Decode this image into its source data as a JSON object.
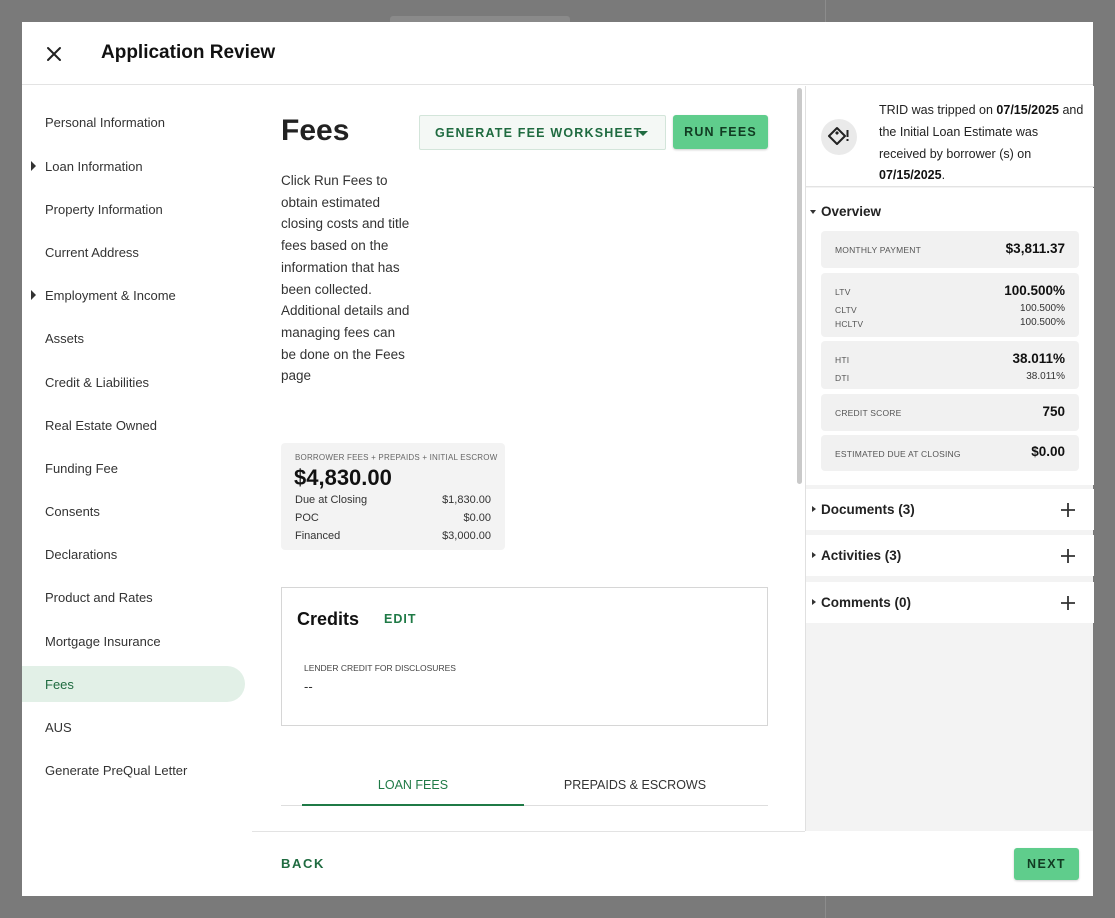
{
  "modal": {
    "title": "Application Review"
  },
  "sidebar": {
    "items": [
      {
        "label": "Personal Information",
        "has_caret": false
      },
      {
        "label": "Loan Information",
        "has_caret": true
      },
      {
        "label": "Property Information",
        "has_caret": false
      },
      {
        "label": "Current Address",
        "has_caret": false
      },
      {
        "label": "Employment & Income",
        "has_caret": true
      },
      {
        "label": "Assets",
        "has_caret": false
      },
      {
        "label": "Credit & Liabilities",
        "has_caret": false
      },
      {
        "label": "Real Estate Owned",
        "has_caret": false
      },
      {
        "label": "Funding Fee",
        "has_caret": false
      },
      {
        "label": "Consents",
        "has_caret": false
      },
      {
        "label": "Declarations",
        "has_caret": false
      },
      {
        "label": "Product and Rates",
        "has_caret": false
      },
      {
        "label": "Mortgage Insurance",
        "has_caret": false
      },
      {
        "label": "Fees",
        "has_caret": false,
        "active": true
      },
      {
        "label": "AUS",
        "has_caret": false
      },
      {
        "label": "Generate PreQual Letter",
        "has_caret": false
      }
    ]
  },
  "main": {
    "title": "Fees",
    "generate_button": "GENERATE FEE WORKSHEET",
    "run_button": "RUN FEES",
    "description": "Click Run Fees to obtain estimated closing costs and title fees based on the information that has been collected. Additional details and managing fees can be done on the Fees page",
    "summary": {
      "caption": "BORROWER FEES + PREPAIDS + INITIAL ESCROW",
      "total": "$4,830.00",
      "rows": [
        {
          "label": "Due at Closing",
          "value": "$1,830.00"
        },
        {
          "label": "POC",
          "value": "$0.00"
        },
        {
          "label": "Financed",
          "value": "$3,000.00"
        }
      ]
    },
    "credits": {
      "title": "Credits",
      "edit_label": "EDIT",
      "field_label": "LENDER CREDIT FOR DISCLOSURES",
      "field_value": "--"
    },
    "tabs": [
      {
        "label": "LOAN FEES",
        "active": true
      },
      {
        "label": "PREPAIDS & ESCROWS",
        "active": false
      }
    ]
  },
  "footer": {
    "back_label": "BACK",
    "next_label": "NEXT"
  },
  "right_panel": {
    "trid": {
      "prefix": "TRID was tripped on ",
      "tripped_date": "07/15/2025",
      "middle": " and the Initial Loan Estimate was received by borrower (s) on ",
      "received_date": "07/15/2025",
      "suffix": "."
    },
    "overview": {
      "heading": "Overview",
      "monthly_payment": {
        "label": "MONTHLY PAYMENT",
        "value": "$3,811.37"
      },
      "ltv": {
        "label": "LTV",
        "value": "100.500%"
      },
      "cltv": {
        "label": "CLTV",
        "value": "100.500%"
      },
      "hcltv": {
        "label": "HCLTV",
        "value": "100.500%"
      },
      "hti": {
        "label": "HTI",
        "value": "38.011%"
      },
      "dti": {
        "label": "DTI",
        "value": "38.011%"
      },
      "credit_score": {
        "label": "CREDIT SCORE",
        "value": "750"
      },
      "due_at_closing": {
        "label": "ESTIMATED DUE AT CLOSING",
        "value": "$0.00"
      }
    },
    "sections": [
      {
        "label": "Documents (3)"
      },
      {
        "label": "Activities (3)"
      },
      {
        "label": "Comments (0)"
      }
    ]
  },
  "colors": {
    "accent_green": "#5fcd8c",
    "text_green": "#1f6b40",
    "active_nav_bg": "#e2f0e7",
    "overlay": "#7a7a7a"
  },
  "icons": {
    "close": "close-icon",
    "dropdown": "chevron-down-icon",
    "trid": "warning-diamond-icon",
    "add": "plus-icon",
    "expand": "caret-right-icon"
  }
}
